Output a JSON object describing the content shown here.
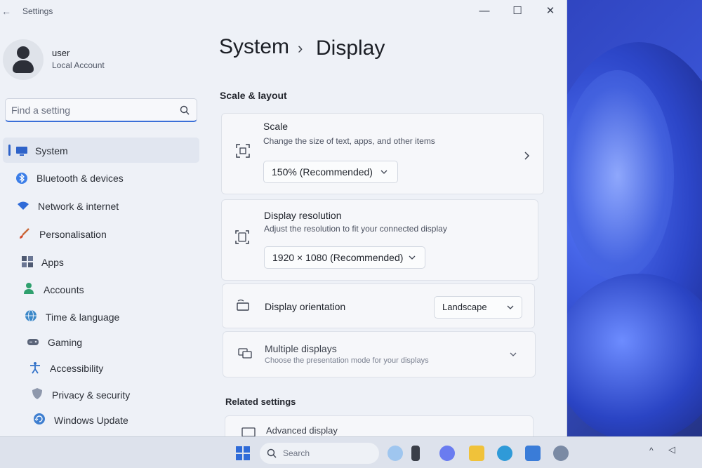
{
  "window": {
    "app_title": "Settings",
    "controls": {
      "minimize": "—",
      "maximize": "☐",
      "close": "✕"
    }
  },
  "user": {
    "name": "user",
    "account_type": "Local Account"
  },
  "search": {
    "placeholder": "Find a setting"
  },
  "sidebar": {
    "items": [
      {
        "label": "System",
        "icon": "monitor-icon",
        "selected": true
      },
      {
        "label": "Bluetooth & devices",
        "icon": "bluetooth-icon"
      },
      {
        "label": "Network & internet",
        "icon": "wifi-icon"
      },
      {
        "label": "Personalisation",
        "icon": "brush-icon"
      },
      {
        "label": "Apps",
        "icon": "apps-icon"
      },
      {
        "label": "Accounts",
        "icon": "person-icon"
      },
      {
        "label": "Time & language",
        "icon": "globe-icon"
      },
      {
        "label": "Gaming",
        "icon": "gamepad-icon"
      },
      {
        "label": "Accessibility",
        "icon": "accessibility-icon"
      },
      {
        "label": "Privacy & security",
        "icon": "shield-icon"
      },
      {
        "label": "Windows Update",
        "icon": "update-icon"
      }
    ]
  },
  "breadcrumb": {
    "parent": "System",
    "separator": "›",
    "current": "Display"
  },
  "scale_layout": {
    "section_title": "Scale & layout",
    "scale": {
      "title": "Scale",
      "subtitle": "Change the size of text, apps, and other items",
      "value": "150% (Recommended)"
    },
    "resolution": {
      "title": "Display resolution",
      "subtitle": "Adjust the resolution to fit your connected display",
      "value": "1920 × 1080 (Recommended)"
    },
    "orientation": {
      "title": "Display orientation",
      "value": "Landscape"
    },
    "multiple_displays": {
      "title": "Multiple displays",
      "subtitle": "Choose the presentation mode for your displays"
    }
  },
  "related": {
    "section_title": "Related settings",
    "advanced_display": "Advanced display"
  },
  "taskbar": {
    "search_label": "Search"
  },
  "colors": {
    "accent": "#2f63c9",
    "window_bg": "#eef1f7",
    "card_bg": "#f6f7fa"
  }
}
